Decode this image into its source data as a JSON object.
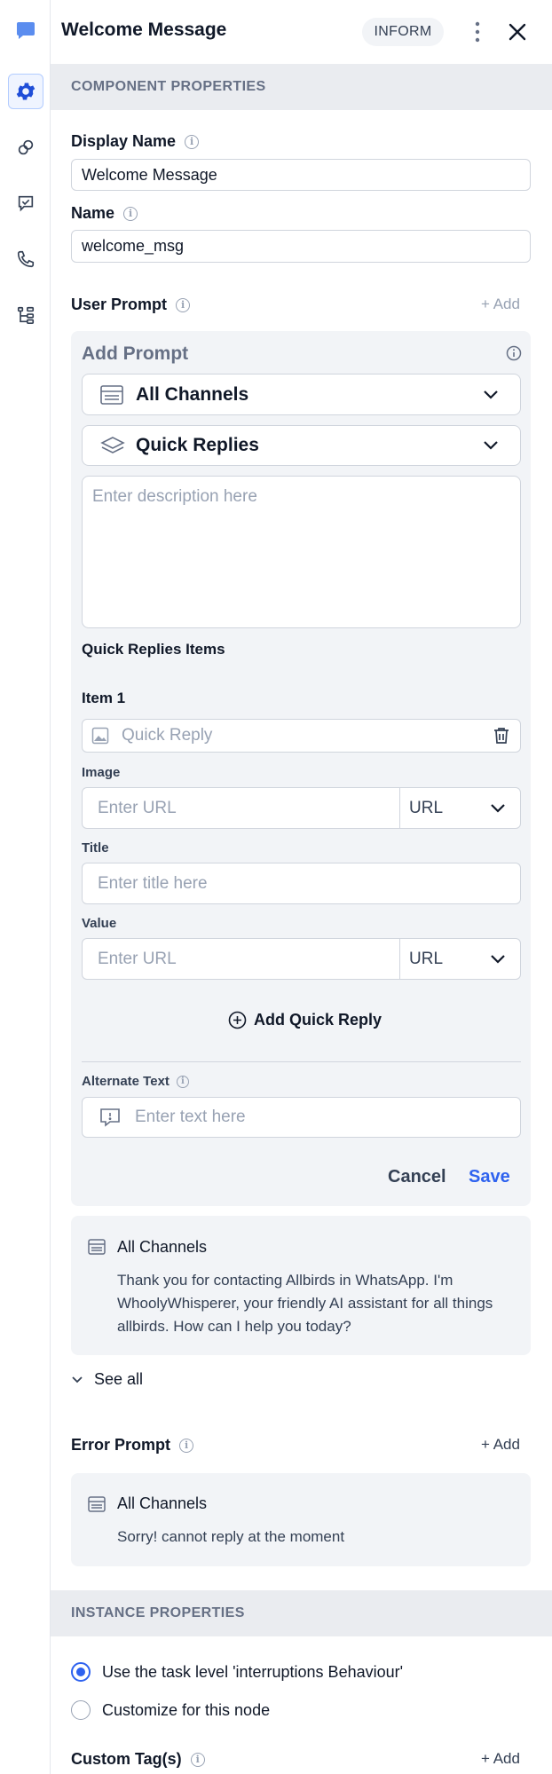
{
  "header": {
    "title": "Welcome Message",
    "badge": "INFORM"
  },
  "rail": {
    "items": [
      "chat-icon",
      "gear-icon",
      "link-icon",
      "checkbox-message-icon",
      "phone-icon",
      "flow-tree-icon"
    ]
  },
  "component_properties": {
    "heading": "COMPONENT PROPERTIES",
    "display_name_label": "Display Name",
    "display_name_value": "Welcome Message",
    "name_label": "Name",
    "name_value": "welcome_msg"
  },
  "user_prompt": {
    "label": "User Prompt",
    "add_label": "+ Add",
    "add_prompt_title": "Add Prompt",
    "channel_select": "All Channels",
    "type_select": "Quick Replies",
    "description_placeholder": "Enter description here",
    "items_heading": "Quick Replies Items",
    "item_title": "Item 1",
    "quick_reply_placeholder": "Quick Reply",
    "image_label": "Image",
    "image_placeholder": "Enter URL",
    "image_type": "URL",
    "title_label": "Title",
    "title_placeholder": "Enter title here",
    "value_label": "Value",
    "value_placeholder": "Enter URL",
    "value_type": "URL",
    "add_quick_reply": "Add Quick Reply",
    "alternate_text_label": "Alternate Text",
    "alternate_text_placeholder": "Enter text here",
    "cancel": "Cancel",
    "save": "Save"
  },
  "existing_prompt": {
    "channel": "All Channels",
    "text": "Thank you for contacting Allbirds in WhatsApp. I'm WhoolyWhisperer, your friendly AI assistant for all things allbirds. How can I help you today?",
    "see_all": "See all"
  },
  "error_prompt": {
    "label": "Error Prompt",
    "add_label": "+ Add",
    "channel": "All Channels",
    "text": "Sorry! cannot reply at the moment"
  },
  "instance_properties": {
    "heading": "INSTANCE PROPERTIES",
    "option_1": "Use the task level 'interruptions Behaviour'",
    "option_2": "Customize for this node",
    "selected": 1,
    "custom_tags_label": "Custom Tag(s)",
    "custom_tags_add": "+ Add"
  },
  "colors": {
    "accent": "#2e62ef",
    "section_bg": "#eaecf0",
    "card_bg": "#f2f4f7"
  }
}
